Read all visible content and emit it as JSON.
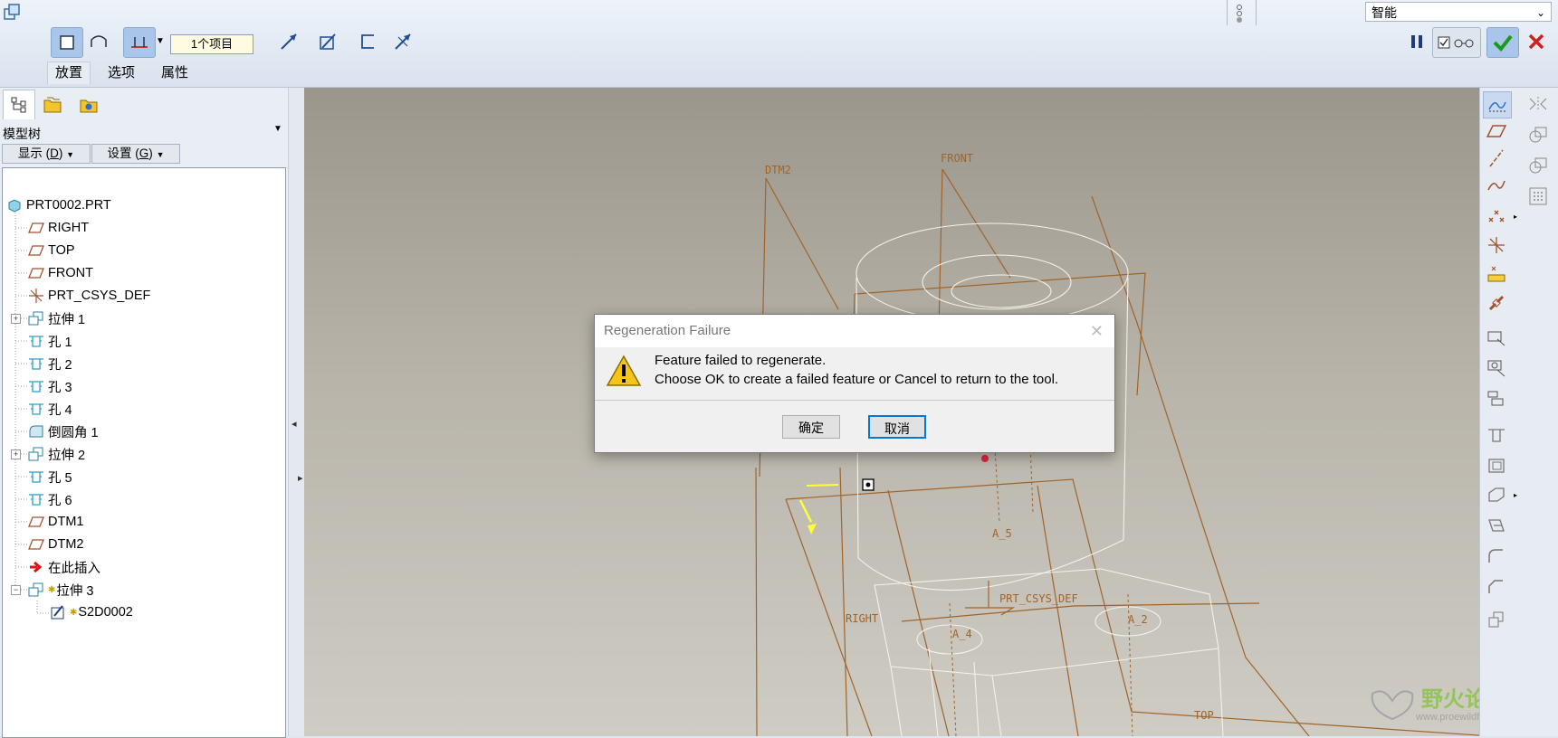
{
  "toolbar": {
    "items_count": "1个项目",
    "tabs": [
      "放置",
      "选项",
      "属性"
    ],
    "filter_value": "智能"
  },
  "model_tree": {
    "title": "模型树",
    "show_button": "显示",
    "show_key": "D",
    "settings_button": "设置",
    "settings_key": "G",
    "nodes": [
      {
        "label": "PRT0002.PRT",
        "icon": "part-icon"
      },
      {
        "label": "RIGHT",
        "icon": "datum-plane-icon"
      },
      {
        "label": "TOP",
        "icon": "datum-plane-icon"
      },
      {
        "label": "FRONT",
        "icon": "datum-plane-icon"
      },
      {
        "label": "PRT_CSYS_DEF",
        "icon": "csys-icon"
      },
      {
        "label": "拉伸 1",
        "icon": "extrude-icon"
      },
      {
        "label": "孔 1",
        "icon": "hole-icon"
      },
      {
        "label": "孔 2",
        "icon": "hole-icon"
      },
      {
        "label": "孔 3",
        "icon": "hole-icon"
      },
      {
        "label": "孔 4",
        "icon": "hole-icon"
      },
      {
        "label": "倒圆角 1",
        "icon": "round-icon"
      },
      {
        "label": "拉伸 2",
        "icon": "extrude-icon"
      },
      {
        "label": "孔 5",
        "icon": "hole-icon"
      },
      {
        "label": "孔 6",
        "icon": "hole-icon"
      },
      {
        "label": "DTM1",
        "icon": "datum-plane-icon"
      },
      {
        "label": "DTM2",
        "icon": "datum-plane-icon"
      },
      {
        "label": "在此插入",
        "icon": "insert-arrow-icon"
      },
      {
        "label": "拉伸 3",
        "icon": "extrude-icon"
      },
      {
        "label": "S2D0002",
        "icon": "sketch-icon"
      }
    ]
  },
  "viewport_labels": {
    "dtm2": "DTM2",
    "front": "FRONT",
    "right": "RIGHT",
    "top": "TOP",
    "csys": "PRT_CSYS_DEF",
    "a5": "A_5",
    "a4": "A_4",
    "a2": "A_2"
  },
  "dialog": {
    "title": "Regeneration Failure",
    "line1": "Feature failed to regenerate.",
    "line2": "Choose OK to create a failed feature or Cancel to return to the tool.",
    "ok_label": "确定",
    "cancel_label": "取消"
  },
  "watermark": {
    "name": "野火论坛",
    "url": "www.proewildfire.cn"
  },
  "colors": {
    "datum": "#b5651d",
    "accent": "#0078d7",
    "confirm": "#1a9a1a",
    "cancel": "#d0201e"
  }
}
